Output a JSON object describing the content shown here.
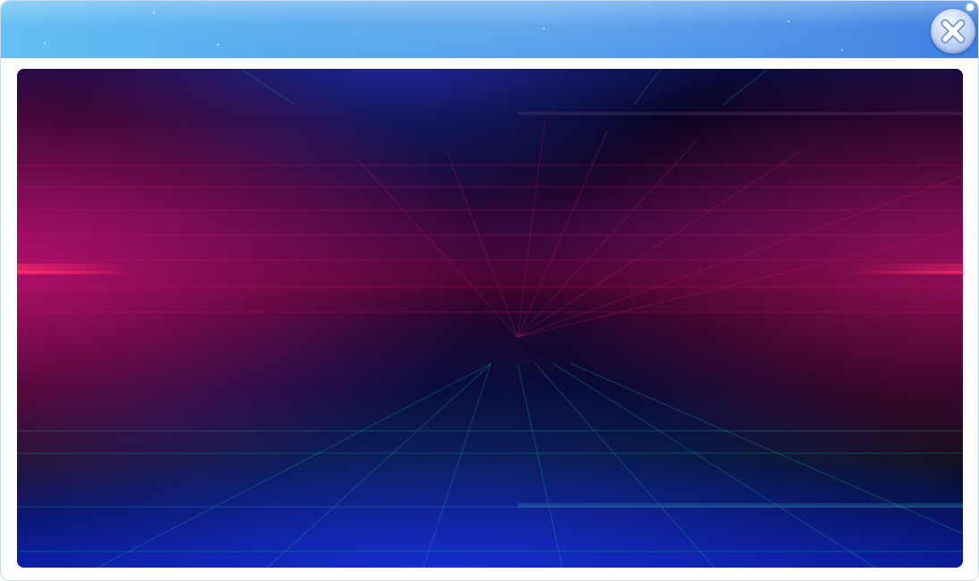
{
  "window": {
    "title": "",
    "close_label": ""
  },
  "icons": {
    "close": "close-icon"
  },
  "colors": {
    "title_bar_start": "#66c0f4",
    "title_bar_end": "#3f7fe0",
    "content_background": "#05041a",
    "grid_magenta": "#c0186a",
    "grid_teal": "#1aa6a0",
    "glow_blue": "#1a28c8"
  }
}
